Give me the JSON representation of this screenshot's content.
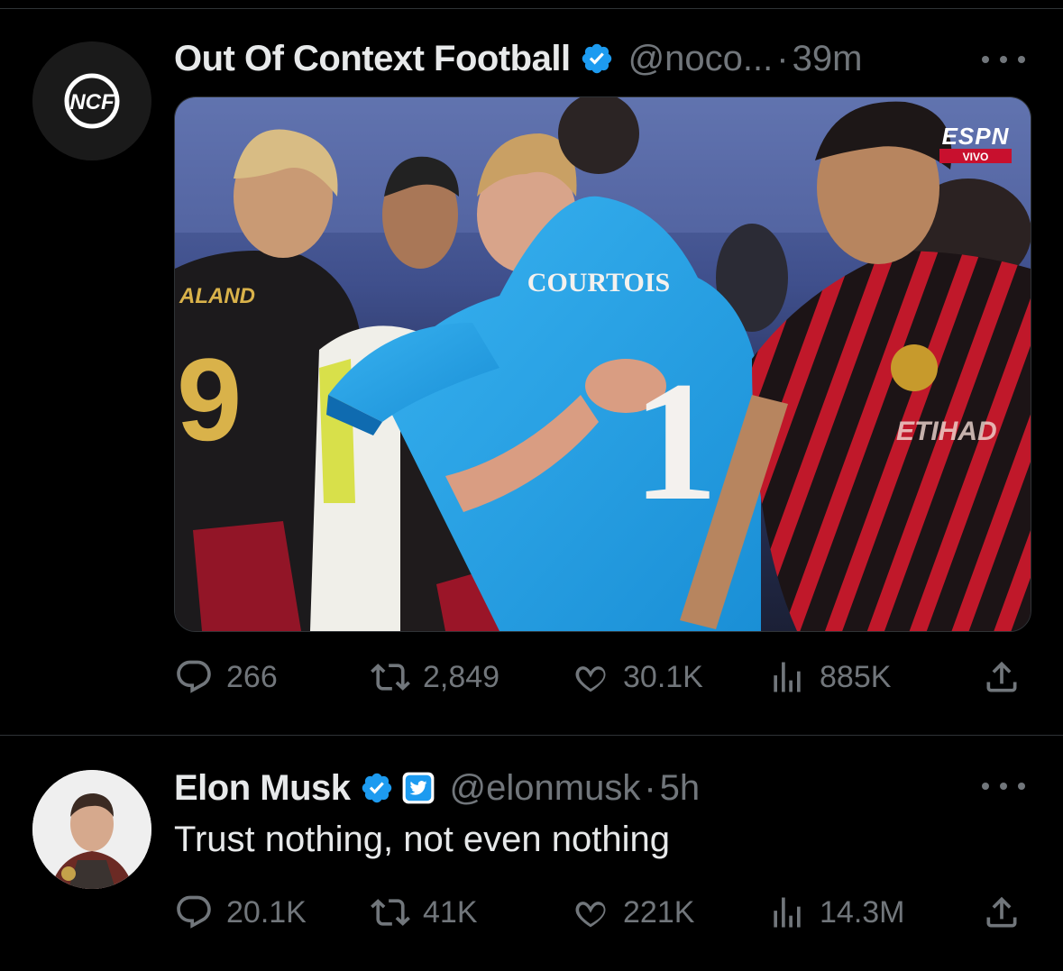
{
  "tweets": [
    {
      "author_name": "Out Of Context Football",
      "handle": "@noco...",
      "separator": "·",
      "time": "39m",
      "avatar_text": "NCF",
      "media": {
        "broadcaster": "ESPN",
        "live_label": "VIVO",
        "jersey_name": "COURTOIS",
        "jersey_number": "1",
        "left_jersey_name": "ALAND",
        "sponsor": "ETIHAD"
      },
      "stats": {
        "replies": "266",
        "retweets": "2,849",
        "likes": "30.1K",
        "views": "885K"
      }
    },
    {
      "author_name": "Elon Musk",
      "handle": "@elonmusk",
      "separator": "·",
      "time": "5h",
      "text": "Trust nothing, not even nothing",
      "stats": {
        "replies": "20.1K",
        "retweets": "41K",
        "likes": "221K",
        "views": "14.3M"
      }
    }
  ],
  "icons": {
    "reply": "reply-icon",
    "retweet": "retweet-icon",
    "like": "heart-icon",
    "views": "views-icon",
    "share": "share-icon",
    "verified": "verified-badge-icon",
    "more": "more-icon"
  },
  "colors": {
    "background": "#000000",
    "text": "#e7e9ea",
    "muted": "#71767b",
    "verified": "#1d9bf0",
    "divider": "#2f3336"
  }
}
